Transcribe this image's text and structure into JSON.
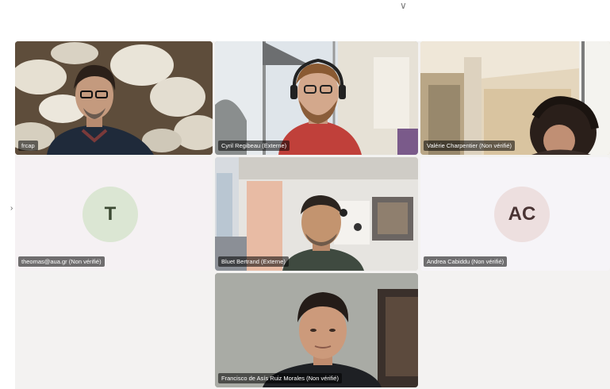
{
  "window": {
    "top_glyph": "∨",
    "left_glyph": "›"
  },
  "participants": [
    {
      "name": "frcap",
      "kind": "video"
    },
    {
      "name": "Cyril Regibeau (Externe)",
      "kind": "video"
    },
    {
      "name": "Valérie Charpentier (Non vérifié)",
      "kind": "video"
    },
    {
      "name": "theomas@aua.gr (Non vérifié)",
      "kind": "avatar",
      "initials": "T",
      "avatar_color": "#dbe6d3"
    },
    {
      "name": "Bluet Bertrand (Externe)",
      "kind": "video"
    },
    {
      "name": "Andrea Cabiddu (Non vérifié)",
      "kind": "avatar",
      "initials": "AC",
      "avatar_color": "#eddfdf"
    },
    {
      "name": "Francisco de Asís Ruiz Morales (Non vérifié)",
      "kind": "video"
    }
  ]
}
